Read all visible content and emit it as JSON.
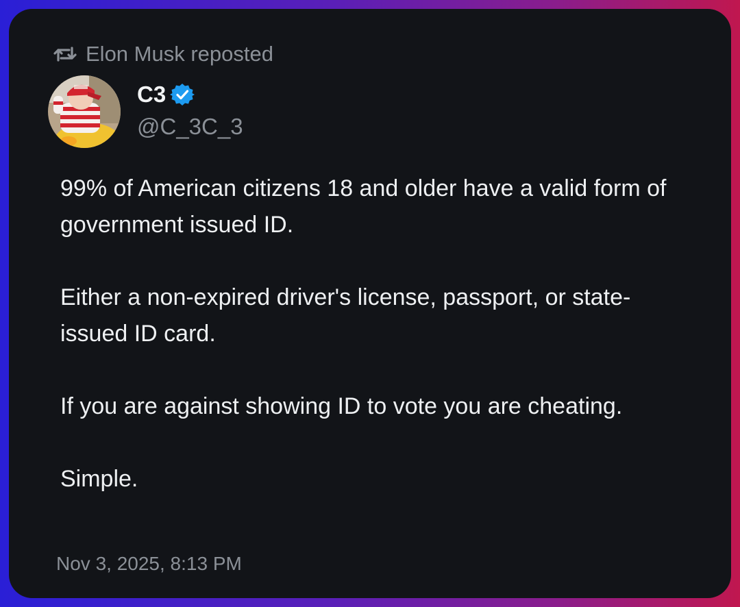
{
  "repost": {
    "icon": "repost-icon",
    "text": "Elon Musk reposted"
  },
  "author": {
    "display_name": "C3",
    "handle": "@C_3C_3",
    "verified": true,
    "verified_color": "#1d9bf0"
  },
  "post": {
    "paragraphs": [
      "99% of American citizens 18 and older have a valid form of government issued ID.",
      "Either a non-expired driver's license, passport, or state-issued ID card.",
      "If you are against showing ID to vote you are cheating.",
      "Simple."
    ],
    "timestamp": "Nov 3, 2025, 8:13 PM"
  },
  "colors": {
    "card_background": "#121418",
    "text_primary": "#eef0f2",
    "text_secondary": "#8b9097"
  }
}
